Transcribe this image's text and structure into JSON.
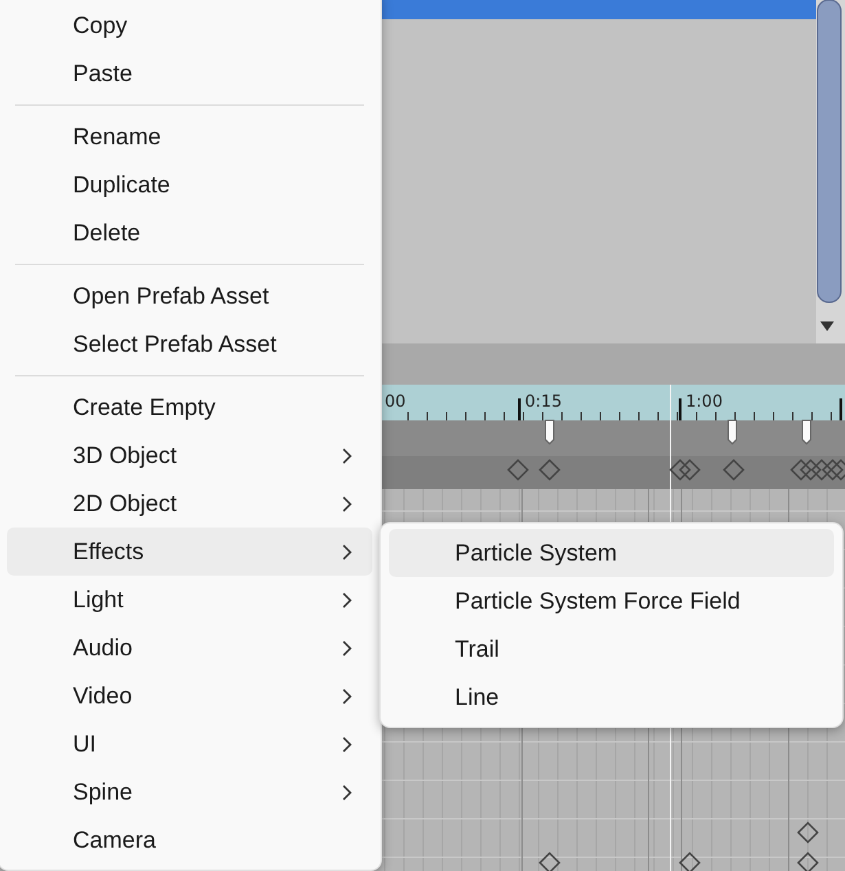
{
  "timeline": {
    "ruler_labels": [
      "00",
      "0:15",
      "1:00"
    ]
  },
  "menu": {
    "items": [
      {
        "kind": "item",
        "label": "Copy",
        "has_submenu": false,
        "selected": false
      },
      {
        "kind": "item",
        "label": "Paste",
        "has_submenu": false,
        "selected": false
      },
      {
        "kind": "separator"
      },
      {
        "kind": "item",
        "label": "Rename",
        "has_submenu": false,
        "selected": false
      },
      {
        "kind": "item",
        "label": "Duplicate",
        "has_submenu": false,
        "selected": false
      },
      {
        "kind": "item",
        "label": "Delete",
        "has_submenu": false,
        "selected": false
      },
      {
        "kind": "separator"
      },
      {
        "kind": "item",
        "label": "Open Prefab Asset",
        "has_submenu": false,
        "selected": false
      },
      {
        "kind": "item",
        "label": "Select Prefab Asset",
        "has_submenu": false,
        "selected": false
      },
      {
        "kind": "separator"
      },
      {
        "kind": "item",
        "label": "Create Empty",
        "has_submenu": false,
        "selected": false
      },
      {
        "kind": "item",
        "label": "3D Object",
        "has_submenu": true,
        "selected": false
      },
      {
        "kind": "item",
        "label": "2D Object",
        "has_submenu": true,
        "selected": false
      },
      {
        "kind": "item",
        "label": "Effects",
        "has_submenu": true,
        "selected": true
      },
      {
        "kind": "item",
        "label": "Light",
        "has_submenu": true,
        "selected": false
      },
      {
        "kind": "item",
        "label": "Audio",
        "has_submenu": true,
        "selected": false
      },
      {
        "kind": "item",
        "label": "Video",
        "has_submenu": true,
        "selected": false
      },
      {
        "kind": "item",
        "label": "UI",
        "has_submenu": true,
        "selected": false
      },
      {
        "kind": "item",
        "label": "Spine",
        "has_submenu": true,
        "selected": false
      },
      {
        "kind": "item",
        "label": "Camera",
        "has_submenu": false,
        "selected": false
      }
    ]
  },
  "submenu": {
    "items": [
      {
        "label": "Particle System",
        "selected": true
      },
      {
        "label": "Particle System Force Field",
        "selected": false
      },
      {
        "label": "Trail",
        "selected": false
      },
      {
        "label": "Line",
        "selected": false
      }
    ]
  }
}
